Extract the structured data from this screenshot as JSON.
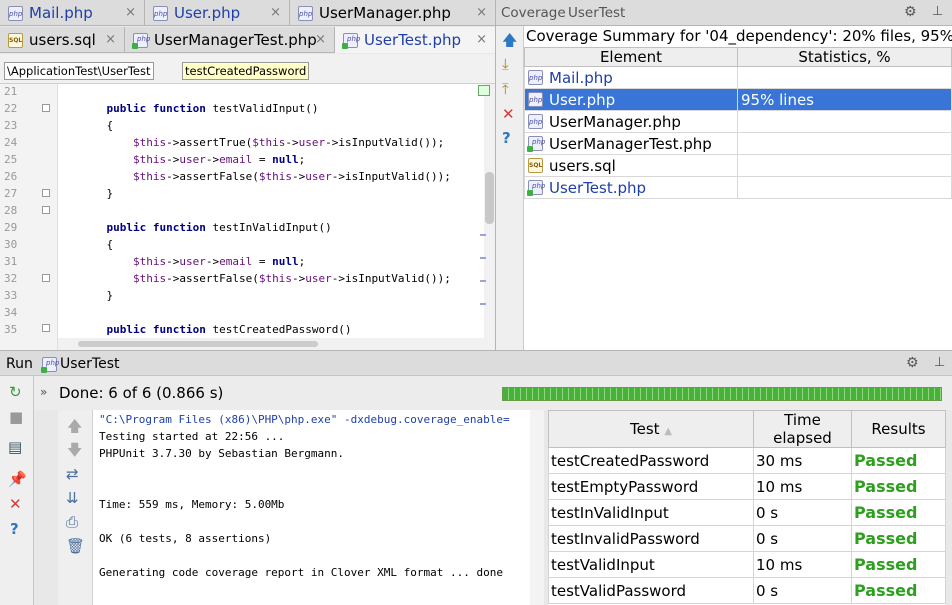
{
  "editor_tabs_row1": [
    {
      "label": "Mail.php",
      "icon": "php-file-icon",
      "blue": true
    },
    {
      "label": "User.php",
      "icon": "php-file-icon",
      "blue": true
    },
    {
      "label": "UserManager.php",
      "icon": "php-file-icon",
      "blue": false
    }
  ],
  "editor_tabs_row2": [
    {
      "label": "users.sql",
      "icon": "sql-file-icon",
      "blue": false
    },
    {
      "label": "UserManagerTest.php",
      "icon": "php-test-file-icon",
      "blue": false
    },
    {
      "label": "UserTest.php",
      "icon": "php-test-file-icon",
      "blue": true,
      "active": true
    }
  ],
  "close_glyph": "×",
  "breadcrumb": {
    "class_path": "\\ApplicationTest\\UserTest",
    "method": "testCreatedPassword"
  },
  "code_lines": [
    {
      "n": "21",
      "text": "    public function testValidInput()"
    },
    {
      "n": "22",
      "text": "    {"
    },
    {
      "n": "23",
      "text": "        $this->assertTrue($this->user->isInputValid());"
    },
    {
      "n": "24",
      "text": "        $this->user->email = null;"
    },
    {
      "n": "25",
      "text": "        $this->assertFalse($this->user->isInputValid());"
    },
    {
      "n": "26",
      "text": "    }"
    },
    {
      "n": "27",
      "text": ""
    },
    {
      "n": "28",
      "text": "    public function testInValidInput()"
    },
    {
      "n": "29",
      "text": "    {"
    },
    {
      "n": "30",
      "text": "        $this->user->email = null;"
    },
    {
      "n": "31",
      "text": "        $this->assertFalse($this->user->isInputValid());"
    },
    {
      "n": "32",
      "text": "    }"
    },
    {
      "n": "33",
      "text": ""
    },
    {
      "n": "34",
      "text": "    public function testCreatedPassword()"
    }
  ],
  "line_numbers": [
    "21",
    "22",
    "23",
    "24",
    "25",
    "26",
    "27",
    "28",
    "29",
    "30",
    "31",
    "32",
    "33",
    "34",
    "35"
  ],
  "coverage": {
    "title": "Coverage",
    "suite": "UserTest",
    "summary": "Coverage Summary for '04_dependency': 20% files, 95% ...",
    "headers": {
      "element": "Element",
      "stats": "Statistics, %"
    },
    "rows": [
      {
        "element": "Mail.php",
        "stats": "",
        "icon": "php-file-icon",
        "blue": true
      },
      {
        "element": "User.php",
        "stats": "95% lines",
        "icon": "php-file-icon",
        "selected": true
      },
      {
        "element": "UserManager.php",
        "stats": "",
        "icon": "php-file-icon"
      },
      {
        "element": "UserManagerTest.php",
        "stats": "",
        "icon": "php-test-file-icon"
      },
      {
        "element": "users.sql",
        "stats": "",
        "icon": "sql-file-icon"
      },
      {
        "element": "UserTest.php",
        "stats": "",
        "icon": "php-test-file-icon",
        "blue": true
      }
    ]
  },
  "run": {
    "tab_label": "Run",
    "config": "UserTest",
    "status": "Done: 6 of 6  (0.866 s)",
    "progress_fraction": 1.0,
    "console": [
      "\"C:\\Program Files (x86)\\PHP\\php.exe\" -dxdebug.coverage_enable=",
      "Testing started at 22:56 ...",
      "PHPUnit 3.7.30 by Sebastian Bergmann.",
      "",
      "",
      "Time: 559 ms, Memory: 5.00Mb",
      "",
      "OK (6 tests, 8 assertions)",
      "",
      "Generating code coverage report in Clover XML format ... done"
    ],
    "results_headers": {
      "test": "Test",
      "time": "Time elapsed",
      "results": "Results"
    },
    "results": [
      {
        "test": "testCreatedPassword",
        "time": "30 ms",
        "result": "Passed"
      },
      {
        "test": "testEmptyPassword",
        "time": "10 ms",
        "result": "Passed"
      },
      {
        "test": "testInValidInput",
        "time": "0 s",
        "result": "Passed"
      },
      {
        "test": "testInvalidPassword",
        "time": "0 s",
        "result": "Passed"
      },
      {
        "test": "testValidInput",
        "time": "10 ms",
        "result": "Passed"
      },
      {
        "test": "testValidPassword",
        "time": "0 s",
        "result": "Passed"
      }
    ]
  }
}
